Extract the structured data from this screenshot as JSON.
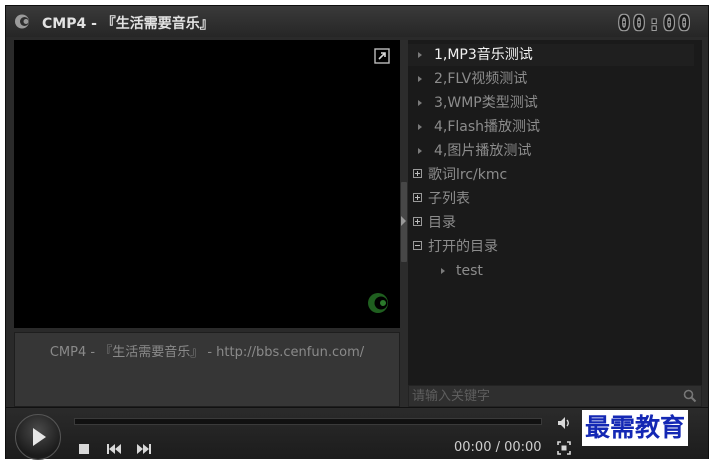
{
  "window": {
    "title": "CMP4 - 『生活需要音乐』",
    "clock": "00:00"
  },
  "video": {
    "caption": "CMP4 - 『生活需要音乐』 - http://bbs.cenfun.com/"
  },
  "playlist": {
    "items": [
      {
        "label": "1,MP3音乐测试",
        "type": "track",
        "active": true
      },
      {
        "label": "2,FLV视频测试",
        "type": "track"
      },
      {
        "label": "3,WMP类型测试",
        "type": "track"
      },
      {
        "label": "4,Flash播放测试",
        "type": "track"
      },
      {
        "label": "4,图片播放测试",
        "type": "track"
      },
      {
        "label": "歌词lrc/kmc",
        "type": "folder",
        "expanded": false
      },
      {
        "label": "子列表",
        "type": "folder",
        "expanded": false
      },
      {
        "label": "目录",
        "type": "folder",
        "expanded": false
      },
      {
        "label": "打开的目录",
        "type": "folder",
        "expanded": true
      },
      {
        "label": "test",
        "type": "child"
      }
    ]
  },
  "search": {
    "placeholder": "请输入关键字"
  },
  "controls": {
    "time": "00:00 / 00:00",
    "progress": 0,
    "volume_level": 0.8
  },
  "overlay": {
    "watermark": "最需教育"
  },
  "colors": {
    "background": "#2a2a2a",
    "video": "#000000",
    "playlist_bg": "#1a1a1a",
    "watermark": "#1428b4"
  }
}
